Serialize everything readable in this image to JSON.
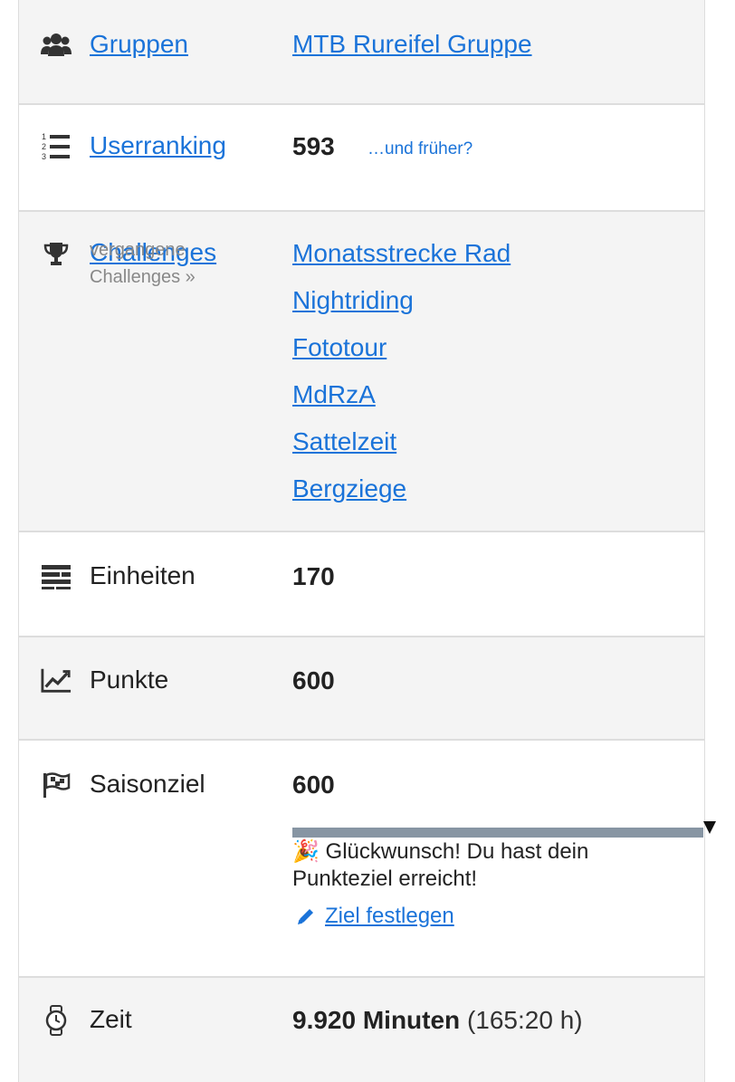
{
  "rows": {
    "gruppen": {
      "label": "Gruppen",
      "value": "MTB Rureifel Gruppe"
    },
    "ranking": {
      "label": "Userranking",
      "value": "593",
      "extra_link": "…und früher?"
    },
    "challenges": {
      "label": "Challenges",
      "past_link_line1": "vergangene",
      "past_link_line2": "Challenges »",
      "items": [
        "Monatsstrecke Rad",
        "Nightriding",
        "Fototour",
        "MdRzA",
        "Sattelzeit",
        "Bergziege"
      ]
    },
    "einheiten": {
      "label": "Einheiten",
      "value": "170"
    },
    "punkte": {
      "label": "Punkte",
      "value": "600"
    },
    "saisonziel": {
      "label": "Saisonziel",
      "value": "600",
      "progress_fraction": 1.0,
      "message": "🎉 Glückwunsch! Du hast dein Punkteziel erreicht!",
      "edit_label": " Ziel festlegen"
    },
    "zeit": {
      "label": "Zeit",
      "value_bold": "9.920 Minuten",
      "value_extra": "(165:20 h)"
    }
  },
  "icons": {
    "gruppen": "users-icon",
    "ranking": "ordered-list-icon",
    "challenges": "trophy-icon",
    "einheiten": "stacked-bars-icon",
    "punkte": "line-chart-icon",
    "saisonziel": "flag-checkered-icon",
    "zeit": "watch-icon",
    "edit": "pencil-icon"
  },
  "colors": {
    "link": "#1a73d9",
    "progress_fill": "#8795a3",
    "row_gray": "#f4f4f4"
  }
}
